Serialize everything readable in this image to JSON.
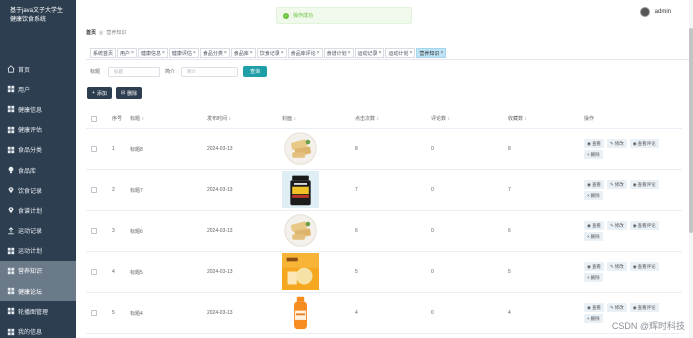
{
  "app": {
    "brand": "基于java文子大学生健康饮食系统"
  },
  "sidebar": {
    "items": [
      {
        "label": "首页",
        "icon": "home-icon"
      },
      {
        "label": "用户",
        "icon": "grid-icon"
      },
      {
        "label": "健康信息",
        "icon": "grid-icon"
      },
      {
        "label": "健康评估",
        "icon": "grid-icon"
      },
      {
        "label": "食品分类",
        "icon": "grid-icon"
      },
      {
        "label": "食品库",
        "icon": "bulb-icon"
      },
      {
        "label": "饮食记录",
        "icon": "pin-icon"
      },
      {
        "label": "食谱计划",
        "icon": "pin-icon"
      },
      {
        "label": "运动记录",
        "icon": "upload-icon"
      },
      {
        "label": "运动计划",
        "icon": "grid-icon"
      },
      {
        "label": "营养知识",
        "icon": "grid-icon"
      },
      {
        "label": "健康论坛",
        "icon": "grid-icon"
      },
      {
        "label": "轮播图管理",
        "icon": "grid-icon"
      },
      {
        "label": "我的信息",
        "icon": "grid-icon"
      }
    ]
  },
  "header": {
    "toast": "操作成功",
    "username": "admin"
  },
  "breadcrumb": {
    "home": "首页",
    "current": "营养知识"
  },
  "tags": [
    {
      "label": "系统首页"
    },
    {
      "label": "用户"
    },
    {
      "label": "健康信息"
    },
    {
      "label": "健康评估"
    },
    {
      "label": "食品分类"
    },
    {
      "label": "食品库"
    },
    {
      "label": "饮食记录"
    },
    {
      "label": "食品库评论"
    },
    {
      "label": "食谱计划"
    },
    {
      "label": "运动记录"
    },
    {
      "label": "运动计划"
    },
    {
      "label": "营养知识"
    }
  ],
  "search": {
    "title_label": "标题",
    "title_placeholder": "标题",
    "intro_label": "简介",
    "intro_placeholder": "简介",
    "query_btn": "查询"
  },
  "toolbar": {
    "add_label": "添加",
    "delete_label": "删除"
  },
  "table": {
    "columns": {
      "no": "序号",
      "title": "标题",
      "date": "发布时间",
      "cover": "封面",
      "clicks": "点击次数",
      "comments": "评论数",
      "favorites": "收藏数",
      "ops": "操作"
    },
    "op_labels": {
      "view": "查看",
      "edit": "修改",
      "comments": "查看评论",
      "delete": "删除"
    },
    "rows": [
      {
        "no": "1",
        "title": "标题8",
        "date": "2024-03-13",
        "clicks": "8",
        "comments": "0",
        "favorites": "8",
        "cover": "bread"
      },
      {
        "no": "2",
        "title": "标题7",
        "date": "2024-03-13",
        "clicks": "7",
        "comments": "0",
        "favorites": "7",
        "cover": "jar"
      },
      {
        "no": "3",
        "title": "标题6",
        "date": "2024-03-13",
        "clicks": "6",
        "comments": "0",
        "favorites": "6",
        "cover": "bread"
      },
      {
        "no": "4",
        "title": "标题5",
        "date": "2024-03-13",
        "clicks": "5",
        "comments": "0",
        "favorites": "5",
        "cover": "snack"
      },
      {
        "no": "5",
        "title": "标题4",
        "date": "2024-03-13",
        "clicks": "4",
        "comments": "0",
        "favorites": "4",
        "cover": "bottle"
      }
    ]
  },
  "watermark": "CSDN @辉时科技",
  "colors": {
    "sidebar": "#2d3e50",
    "accent": "#1e9fa8",
    "toast": "#67c23a",
    "active_tag": "#bde3f5"
  }
}
